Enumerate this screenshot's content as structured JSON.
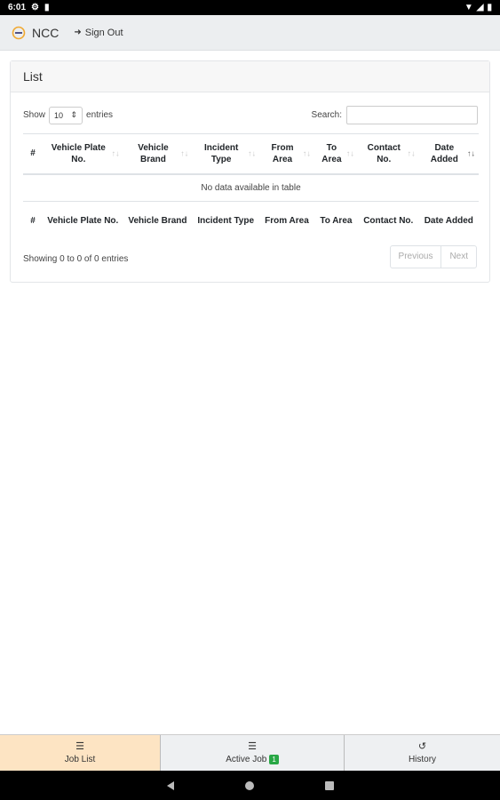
{
  "status_bar": {
    "time": "6:01",
    "icons": [
      "gear-icon",
      "sd-card-icon",
      "wifi-icon",
      "signal-icon",
      "battery-icon"
    ]
  },
  "navbar": {
    "brand": "NCC",
    "sign_out": "Sign Out"
  },
  "card": {
    "title": "List",
    "show_label": "Show",
    "entries_value": "10",
    "entries_label": "entries",
    "search_label": "Search:",
    "search_value": "",
    "columns": [
      "#",
      "Vehicle Plate No.",
      "Vehicle Brand",
      "Incident Type",
      "From Area",
      "To Area",
      "Contact No.",
      "Date Added"
    ],
    "empty_message": "No data available in table",
    "info": "Showing 0 to 0 of 0 entries",
    "previous": "Previous",
    "next": "Next"
  },
  "bottom_nav": {
    "job_list": "Job List",
    "active_job": "Active Job",
    "active_job_badge": "1",
    "history": "History"
  },
  "colors": {
    "active_tab": "#fde4c3",
    "badge": "#28a745",
    "logo_accent": "#f0a830"
  }
}
